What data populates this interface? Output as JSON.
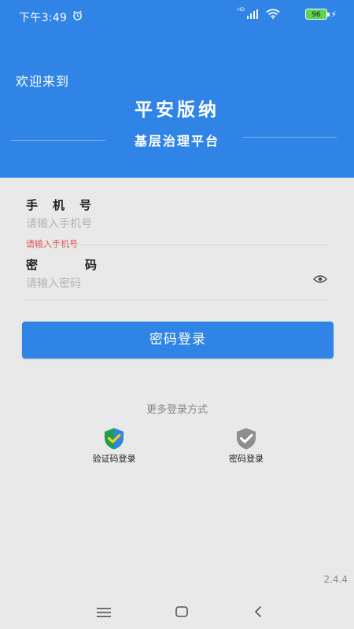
{
  "status_bar": {
    "time": "下午3:49",
    "network": "HD",
    "battery": "96"
  },
  "header": {
    "welcome": "欢迎来到",
    "app_name": "平安版纳",
    "subtitle": "基层治理平台"
  },
  "form": {
    "phone_label": "手机号",
    "phone_placeholder": "请输入手机号",
    "phone_error": "请输入手机号",
    "password_label": "密码",
    "password_placeholder": "请输入密码"
  },
  "login_button": "密码登录",
  "more_login": {
    "title": "更多登录方式",
    "methods": [
      {
        "label": "验证码登录",
        "icon": "shield-check-icon-active"
      },
      {
        "label": "密码登录",
        "icon": "shield-check-icon-inactive"
      }
    ]
  },
  "version": "2.4.4",
  "colors": {
    "primary": "#2f84e6",
    "error": "#e04545",
    "background": "#e9e9e9"
  }
}
